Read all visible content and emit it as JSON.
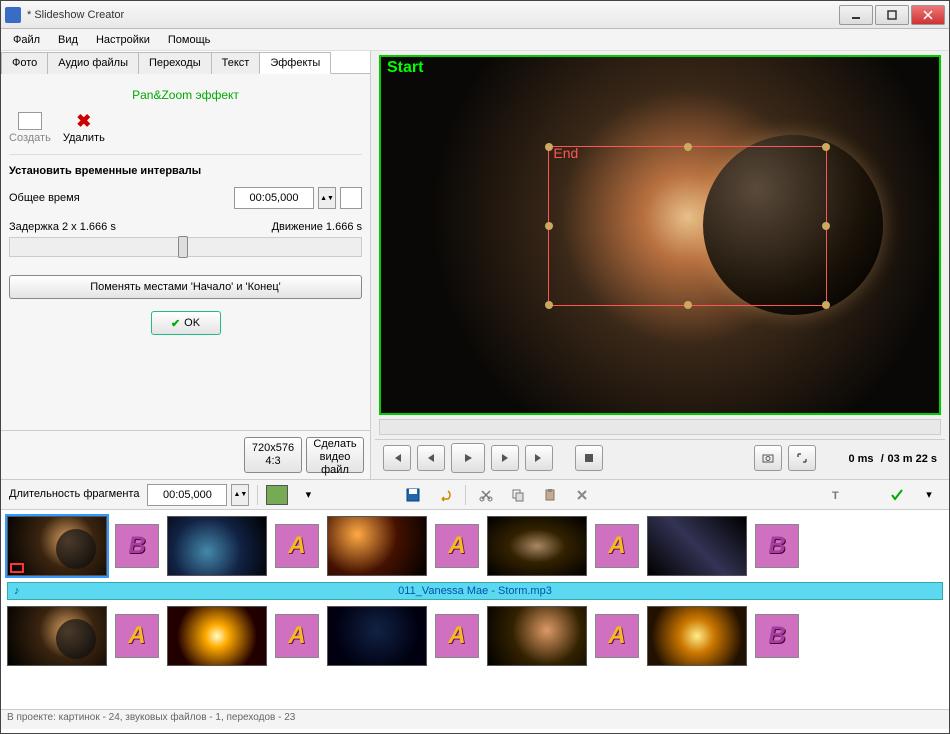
{
  "title": "* Slideshow Creator",
  "menu": [
    "Файл",
    "Вид",
    "Настройки",
    "Помощь"
  ],
  "tabs": [
    "Фото",
    "Аудио файлы",
    "Переходы",
    "Текст",
    "Эффекты"
  ],
  "active_tab": 4,
  "effect": {
    "title": "Pan&Zoom эффект",
    "create_label": "Создать",
    "delete_label": "Удалить",
    "section_title": "Установить временные интервалы",
    "total_time_label": "Общее время",
    "total_time_value": "00:05,000",
    "delay_label": "Задержка 2 x 1.666 s",
    "motion_label": "Движение 1.666 s",
    "swap_btn": "Поменять местами 'Начало' и 'Конец'",
    "ok_btn": "OK"
  },
  "bottom_btns": {
    "resolution_line1": "720x576",
    "resolution_line2": "4:3",
    "export_line1": "Сделать",
    "export_line2": "видео файл"
  },
  "preview": {
    "start_label": "Start",
    "end_label": "End"
  },
  "playback": {
    "time_current": "0 ms",
    "time_sep": "/",
    "time_total": "03 m 22 s"
  },
  "fragment": {
    "label": "Длительность фрагмента",
    "value": "00:05,000"
  },
  "audio_track": "011_Vanessa Mae - Storm.mp3",
  "status": "В проекте: картинок - 24, звуковых файлов - 1, переходов - 23",
  "transitions_row1": [
    "B",
    "A",
    "A",
    "A",
    "B"
  ],
  "transitions_row2": [
    "A",
    "A",
    "A",
    "A",
    "B"
  ]
}
